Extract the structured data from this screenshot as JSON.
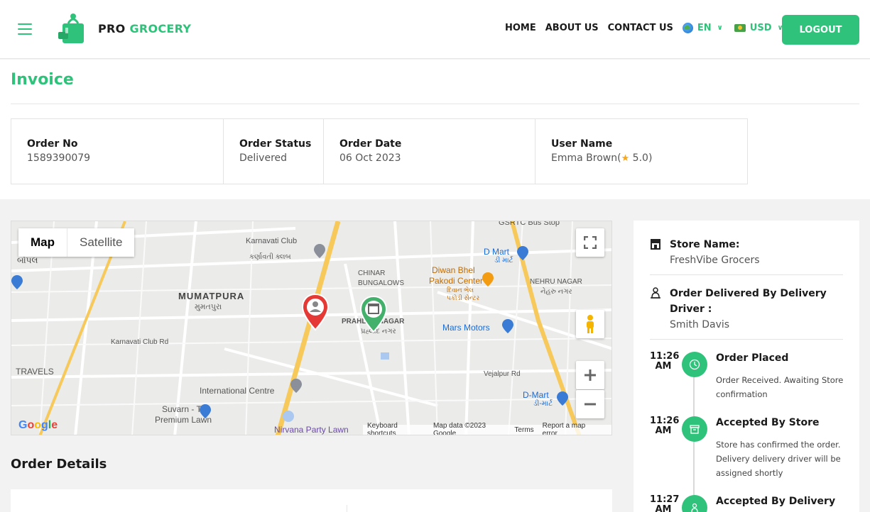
{
  "header": {
    "brand_pro": "PRO",
    "brand_grocery": "GROCERY",
    "nav": [
      "HOME",
      "ABOUT US",
      "CONTACT US"
    ],
    "language": "EN",
    "currency": "USD",
    "logout_label": "LOGOUT"
  },
  "invoice": {
    "title": "Invoice",
    "fields": [
      {
        "label": "Order No",
        "value": "1589390079"
      },
      {
        "label": "Order Status",
        "value": "Delivered"
      },
      {
        "label": "Order Date",
        "value": "06 Oct 2023"
      },
      {
        "label": "User Name",
        "value": "Emma Brown(",
        "rating": "5.0",
        "suffix": ")"
      }
    ]
  },
  "map": {
    "type_map": "Map",
    "type_satellite": "Satellite",
    "labels": {
      "karnavati_club": "Karnavati Club",
      "karnavati_club_gu": "કર્ણાવતી ક્લબ",
      "mumatpura": "MUMATPURA",
      "mumatpura_gu": "મુમતપુરા",
      "chinar": "CHINAR",
      "bungalows": "BUNGALOWS",
      "prahlad_nagar": "PRAHLAD NAGAR",
      "prahlad_gu": "પ્રહ્લાદ નગર",
      "diwan_bhel": "Diwan Bhel",
      "pakodi_center": "Pakodi Center",
      "diwan_gu": "દિવાન ભેલ પકોડી સેન્ટર",
      "d_mart": "D Mart",
      "d_mart_gu": "ડી માર્ટ",
      "nehru_nagar": "NEHRU NAGAR",
      "nehru_gu": "નેહરુ નગર",
      "mars_motors": "Mars Motors",
      "karnavati_club_rd": "Karnavati Club Rd",
      "travels": "TRAVELS",
      "intl_centre": "International Centre",
      "suvarn": "Suvarn - The",
      "premium_lawn": "Premium Lawn",
      "nirvana": "Nirvana Party Lawn",
      "vejalpur": "Vejalpur Rd",
      "d_mart2": "D-Mart",
      "d_mart2_gu": "ડી-માર્ટ",
      "gsrtc": "GSRTC Bus Stop",
      "bopal_gu": "બોપલ"
    },
    "footer": [
      "Keyboard shortcuts",
      "Map data ©2023 Google",
      "Terms",
      "Report a map error"
    ],
    "google": "Google"
  },
  "order_details": {
    "title": "Order Details"
  },
  "panel": {
    "store_label": "Store Name:",
    "store_name": "FreshVibe Grocers",
    "driver_label": "Order Delivered By Delivery Driver :",
    "driver_name": "Smith Davis",
    "timeline": [
      {
        "time": "11:26 AM",
        "title": "Order Placed",
        "desc": "Order Received. Awaiting Store confirmation",
        "icon": "clock-icon"
      },
      {
        "time": "11:26 AM",
        "title": "Accepted By Store",
        "desc": "Store has confirmed the order. Delivery delivery driver will be assigned shortly",
        "icon": "store-icon"
      },
      {
        "time": "11:27 AM",
        "title": "Accepted By Delivery",
        "desc": "",
        "icon": "driver-icon"
      }
    ]
  },
  "colors": {
    "accent": "#2fc27a",
    "pin_user": "#e53935",
    "pin_store": "#43b06b"
  }
}
